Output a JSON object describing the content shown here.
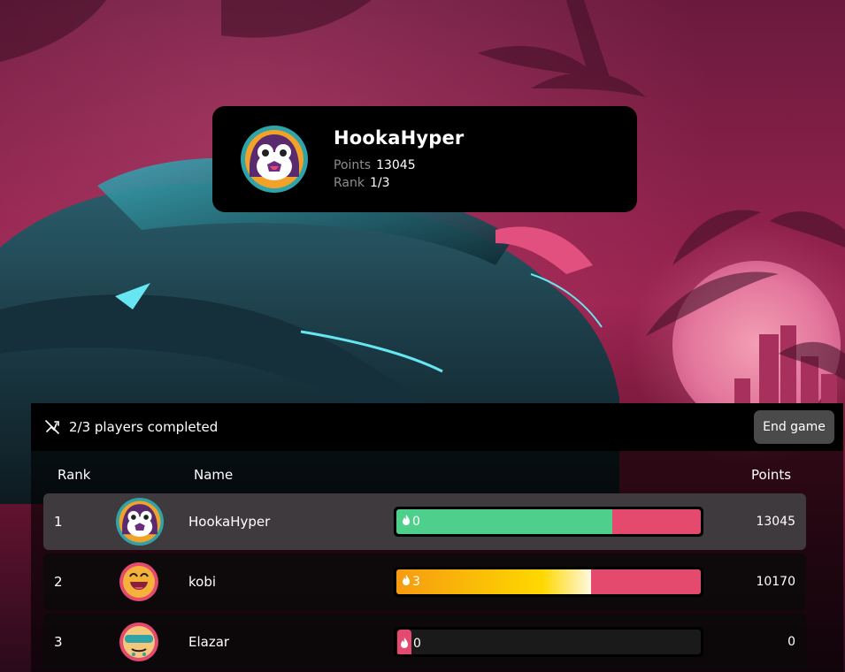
{
  "player_card": {
    "name": "HookaHyper",
    "points_label": "Points",
    "points_value": "13045",
    "rank_label": "Rank",
    "rank_value": "1/3",
    "avatar_icon": "penguin-avatar-icon"
  },
  "status": {
    "text": "2/3 players completed",
    "icon": "no-gun-icon"
  },
  "end_button": {
    "label": "End game"
  },
  "columns": {
    "rank": "Rank",
    "name": "Name",
    "points": "Points"
  },
  "colors": {
    "green": "#4fcf8c",
    "pink": "#e34a6e",
    "orange_start": "#f59b10",
    "yellow": "#ffd800",
    "panel_bg": "#000000"
  },
  "rows": [
    {
      "rank": "1",
      "name": "HookaHyper",
      "streak": "0",
      "points": "13045",
      "progress": 0.71,
      "fill": "green",
      "avatar_icon": "penguin-avatar-icon"
    },
    {
      "rank": "2",
      "name": "kobi",
      "streak": "3",
      "points": "10170",
      "progress": 0.64,
      "fill": "fire",
      "avatar_icon": "laughing-face-avatar-icon"
    },
    {
      "rank": "3",
      "name": "Elazar",
      "streak": "0",
      "points": "0",
      "progress": 0.0,
      "fill": "none",
      "avatar_icon": "sunglasses-face-avatar-icon"
    }
  ]
}
